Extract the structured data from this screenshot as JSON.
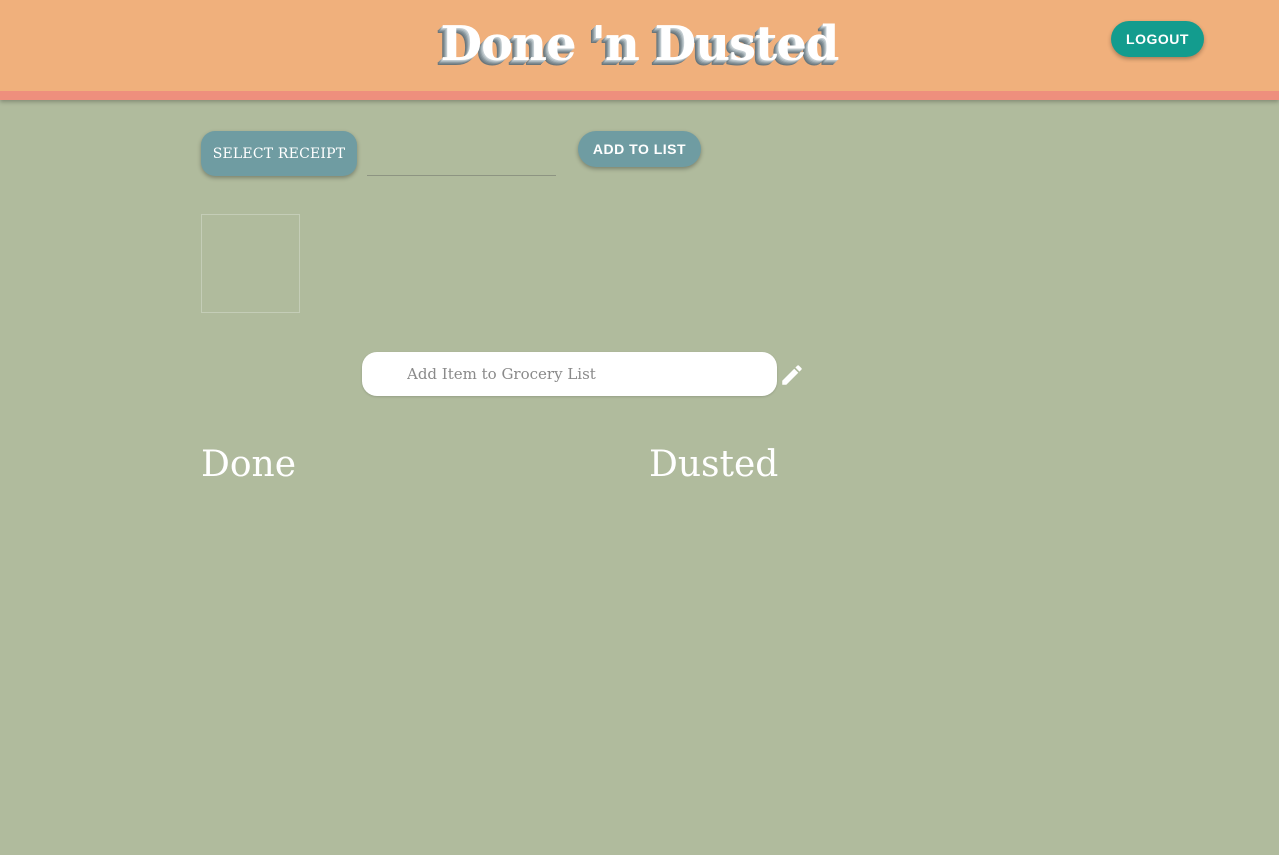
{
  "header": {
    "title": "Done 'n Dusted",
    "logout_label": "LOGOUT"
  },
  "upload": {
    "select_receipt_label": "SELECT RECEIPT",
    "file_path_value": "",
    "add_to_list_label": "ADD TO LIST"
  },
  "grocery": {
    "input_placeholder": "Add Item to Grocery List",
    "input_value": "",
    "edit_icon": "pencil-icon"
  },
  "columns": {
    "done_heading": "Done",
    "dusted_heading": "Dusted",
    "done_items": [],
    "dusted_items": []
  },
  "colors": {
    "background": "#b0bb9d",
    "header": "#f0b07c",
    "header_border": "#ee8f7d",
    "logout_button": "#139c8e",
    "secondary_button": "#6f9ca2"
  }
}
